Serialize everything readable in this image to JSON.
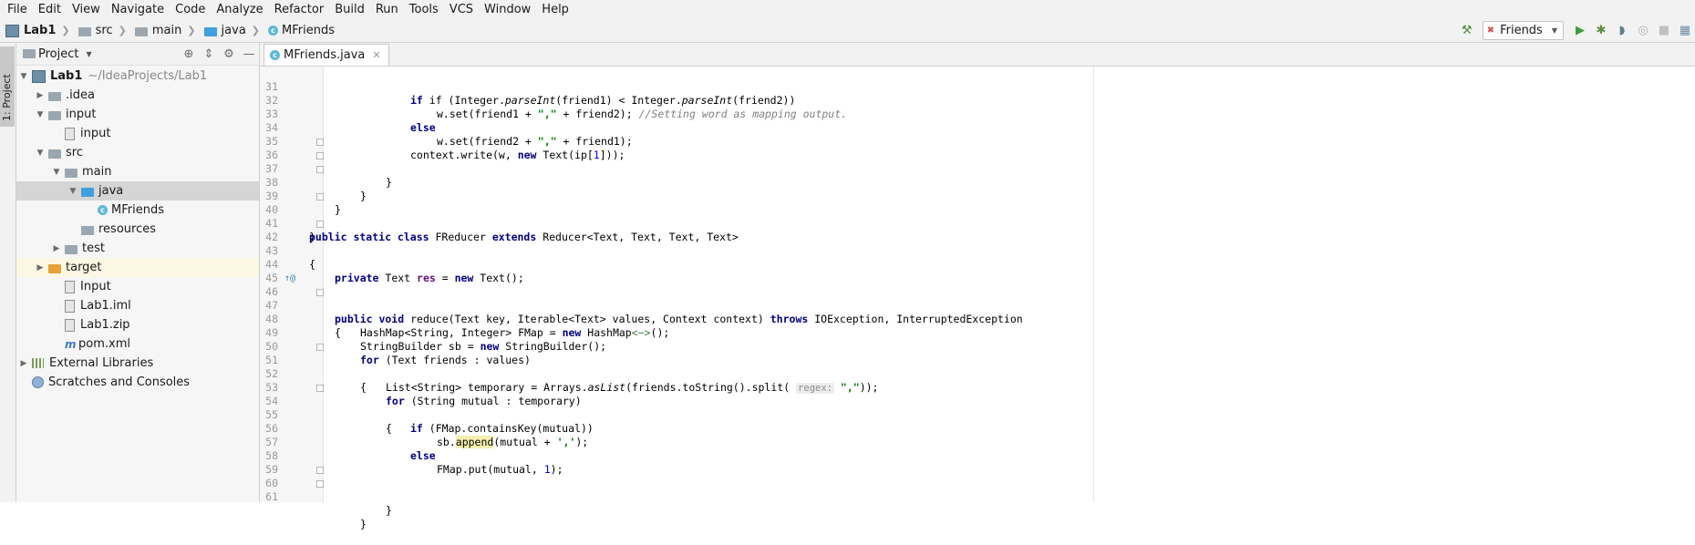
{
  "menu": [
    "File",
    "Edit",
    "View",
    "Navigate",
    "Code",
    "Analyze",
    "Refactor",
    "Build",
    "Run",
    "Tools",
    "VCS",
    "Window",
    "Help"
  ],
  "breadcrumb": [
    "Lab1",
    "src",
    "main",
    "java",
    "MFriends"
  ],
  "run_config": "Friends",
  "sidebar_tab": "1: Project",
  "project_panel": {
    "title": "Project",
    "tree": [
      {
        "label": "Lab1",
        "extra": "~/IdeaProjects/Lab1"
      },
      {
        "label": ".idea"
      },
      {
        "label": "input"
      },
      {
        "label": "input"
      },
      {
        "label": "src"
      },
      {
        "label": "main"
      },
      {
        "label": "java"
      },
      {
        "label": "MFriends"
      },
      {
        "label": "resources"
      },
      {
        "label": "test"
      },
      {
        "label": "target"
      },
      {
        "label": "Input"
      },
      {
        "label": "Lab1.iml"
      },
      {
        "label": "Lab1.zip"
      },
      {
        "label": "pom.xml"
      },
      {
        "label": "External Libraries"
      },
      {
        "label": "Scratches and Consoles"
      }
    ]
  },
  "editor": {
    "tab": "MFriends.java",
    "line_numbers": [
      "31",
      "32",
      "33",
      "34",
      "35",
      "36",
      "37",
      "38",
      "39",
      "40",
      "41",
      "42",
      "43",
      "44",
      "45",
      "46",
      "47",
      "48",
      "49",
      "50",
      "51",
      "52",
      "53",
      "54",
      "55",
      "56",
      "57",
      "58",
      "59",
      "60",
      "61"
    ],
    "lines": {
      "l31": [
        " if (Integer.",
        "parseInt",
        "(friend1) < Integer.",
        "parseInt",
        "(friend2))"
      ],
      "l32": [
        "w.set(friend1 + ",
        "\",\"",
        " + friend2); ",
        "//Setting word as mapping output."
      ],
      "l33": [
        "else"
      ],
      "l34": [
        "w.set(friend2 + ",
        "\",\"",
        " + friend1);"
      ],
      "l35": [
        "context.write(w, ",
        "new",
        " Text(ip[",
        "1",
        "]));"
      ],
      "l36": [
        "}"
      ],
      "l37": [
        "}"
      ],
      "l38": [
        "}"
      ],
      "l40": [
        "}"
      ],
      "l41": [
        "public static class",
        " FReducer ",
        "extends",
        " Reducer<Text, Text, Text, Text>"
      ],
      "l42": [
        "{"
      ],
      "l44": [
        "private",
        " Text ",
        "res",
        " = ",
        "new",
        " Text();"
      ],
      "l46": [
        "public void",
        " reduce(Text key, Iterable<Text> values, Context context) ",
        "throws",
        " IOException, InterruptedException"
      ],
      "l47": [
        "{"
      ],
      "l48": [
        "HashMap<String, Integer> FMap = ",
        "new",
        " HashMap",
        "<~>",
        "();"
      ],
      "l49": [
        "StringBuilder sb = ",
        "new",
        " StringBuilder();"
      ],
      "l50": [
        "for",
        " (Text friends : values)"
      ],
      "l51": [
        "{"
      ],
      "l52": [
        "List<String> temporary = Arrays.",
        "asList",
        "(friends.toString().split( ",
        "regex:",
        " ",
        "\",\"",
        "));"
      ],
      "l53": [
        "for",
        " (String mutual : temporary)"
      ],
      "l54": [
        "{"
      ],
      "l55": [
        "if",
        " (FMap.containsKey(mutual))"
      ],
      "l56": [
        "sb.",
        "append",
        "(mutual + ",
        "','",
        ");"
      ],
      "l57": [
        "else"
      ],
      "l58": [
        "FMap.put(mutual, ",
        "1",
        ");"
      ],
      "l60": [
        "}"
      ],
      "l61": [
        "}"
      ]
    },
    "gutter_marks": "↑@"
  },
  "colors": {
    "keyword": "#000080",
    "string": "#008000",
    "comment": "#808080",
    "number": "#0000ff",
    "field": "#660e7a"
  }
}
